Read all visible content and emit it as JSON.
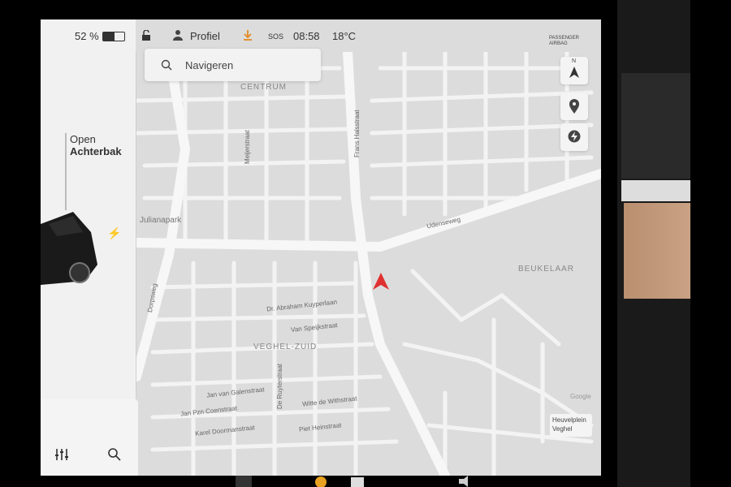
{
  "status": {
    "battery_percent": "52 %",
    "battery_level": 0.52,
    "profile_label": "Profiel",
    "time": "08:58",
    "temperature": "18°C",
    "sos": "SOS"
  },
  "left_panel": {
    "trunk_label_1": "Open",
    "trunk_label_2": "Achterbak"
  },
  "search": {
    "placeholder": "Navigeren"
  },
  "airbag": {
    "line1": "PASSENGER",
    "line2": "AIRBAG"
  },
  "map": {
    "streets": [
      "CENTRUM",
      "Frans Halsstraat",
      "Julianapark",
      "Udenseweg",
      "BEUKELAAR",
      "Dr. Abraham Kuyperlaan",
      "Van Speijkstraat",
      "VEGHEL-ZUID",
      "Jan van Galenstraat",
      "Witte de Withstraat",
      "Jan Pzn Coenstraat",
      "Karel Doormanstraat",
      "Piet Heinstraat",
      "De Ruyterstraat",
      "Meijerstraat",
      "Dorpsweg"
    ],
    "google": "Google",
    "place_card": {
      "line1": "Heuvelplein",
      "line2": "Veghel"
    }
  },
  "compass": "N",
  "colors": {
    "map_bg": "#dcdcdc",
    "road": "#f2f2f2",
    "arrow": "#e03030"
  }
}
